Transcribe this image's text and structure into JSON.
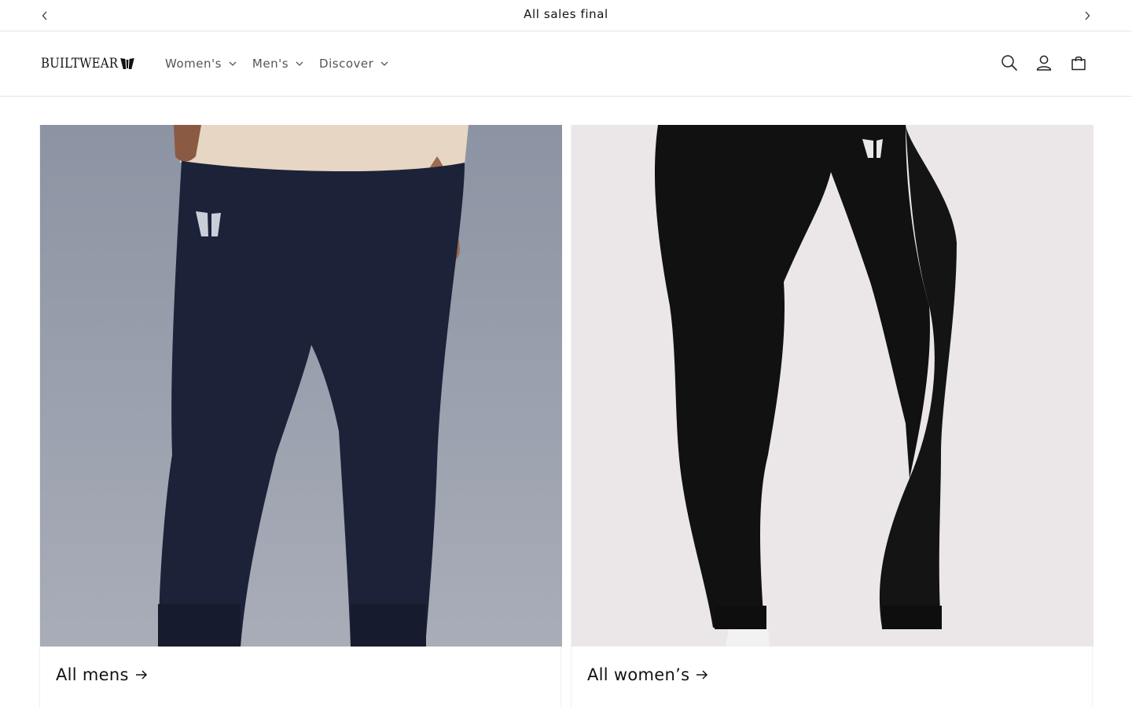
{
  "announcement": {
    "text": "All sales final",
    "prev_icon": "chevron-left-icon",
    "next_icon": "chevron-right-icon"
  },
  "header": {
    "logo_text": "BUILTWEAR",
    "nav": [
      {
        "label": "Women's",
        "icon": "chevron-down-icon"
      },
      {
        "label": "Men's",
        "icon": "chevron-down-icon"
      },
      {
        "label": "Discover",
        "icon": "chevron-down-icon"
      }
    ],
    "icons": [
      "search-icon",
      "account-icon",
      "cart-icon"
    ]
  },
  "collections": [
    {
      "label": "All mens",
      "image": "navy joggers on model",
      "icon": "arrow-right-icon"
    },
    {
      "label": "All women’s",
      "image": "black leggings on model",
      "icon": "arrow-right-icon"
    }
  ],
  "colors": {
    "text": "#121212",
    "nav_text": "#555555",
    "border": "#e6e6e6",
    "mens_bg": "#9aa0ad",
    "mens_pants": "#1c2238",
    "womens_bg": "#e9e5e7",
    "womens_leggings": "#121212"
  }
}
